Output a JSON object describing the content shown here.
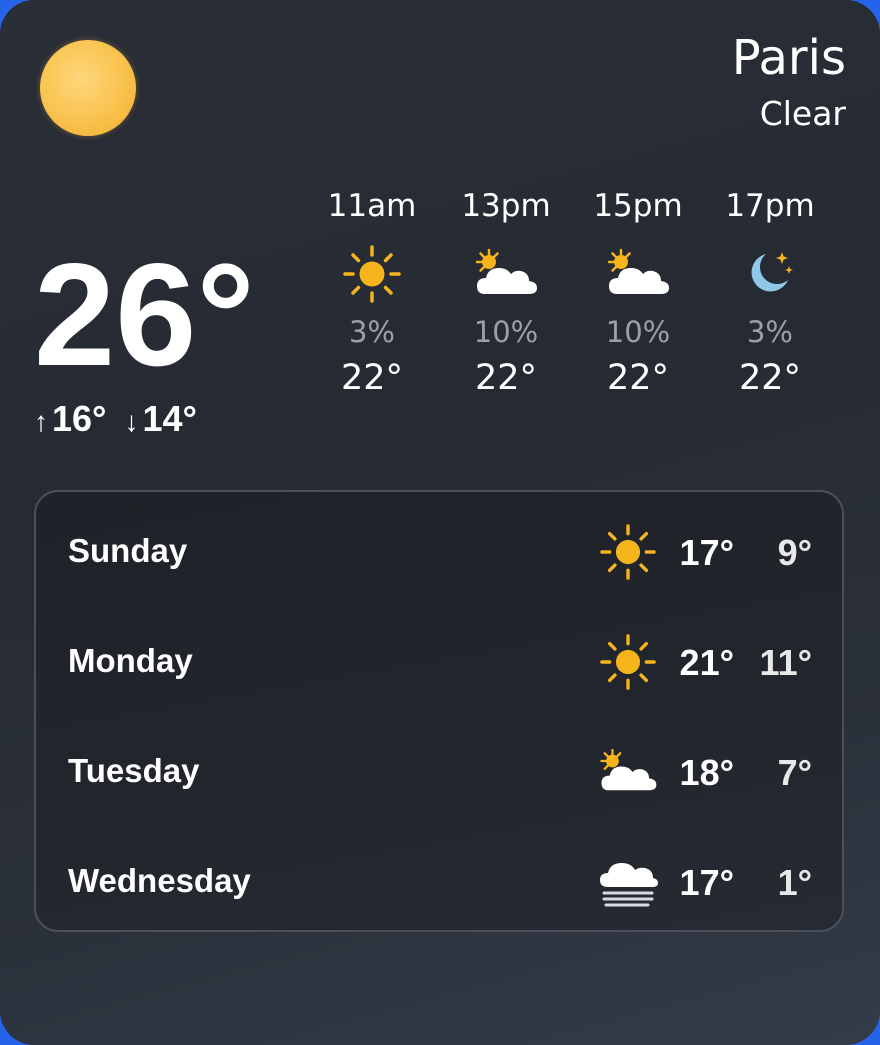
{
  "current": {
    "city": "Paris",
    "condition": "Clear",
    "temp": "26°",
    "high": "16°",
    "low": "14°",
    "high_arrow": "↑",
    "low_arrow": "↓",
    "icon": "sun-icon"
  },
  "hourly": [
    {
      "time": "11am",
      "icon": "sun-icon",
      "precip": "3%",
      "temp": "22°"
    },
    {
      "time": "13pm",
      "icon": "partly-cloudy-icon",
      "precip": "10%",
      "temp": "22°"
    },
    {
      "time": "15pm",
      "icon": "partly-cloudy-icon",
      "precip": "10%",
      "temp": "22°"
    },
    {
      "time": "17pm",
      "icon": "moon-stars-icon",
      "precip": "3%",
      "temp": "22°"
    }
  ],
  "daily": [
    {
      "day": "Sunday",
      "icon": "sun-icon",
      "high": "17°",
      "low": "9°"
    },
    {
      "day": "Monday",
      "icon": "sun-icon",
      "high": "21°",
      "low": "11°"
    },
    {
      "day": "Tuesday",
      "icon": "partly-cloudy-icon",
      "high": "18°",
      "low": "7°"
    },
    {
      "day": "Wednesday",
      "icon": "fog-icon",
      "high": "17°",
      "low": "1°"
    }
  ],
  "colors": {
    "sun": "#f5b31c",
    "cloud": "#ffffff",
    "moon": "#8fc7e8",
    "card_bg": "#262a32",
    "muted_text": "#9aa0aa"
  }
}
